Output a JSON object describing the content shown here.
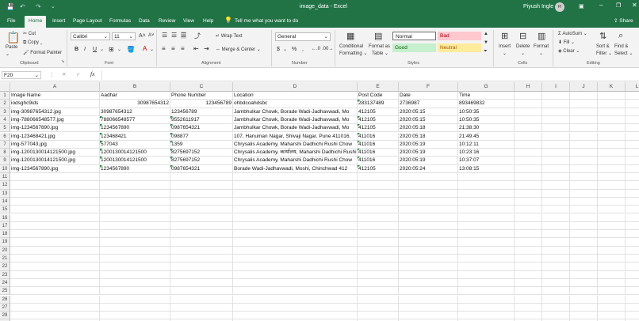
{
  "title": {
    "filename": "image_data",
    "separator": "-",
    "app": "Excel",
    "user": "Piyush Ingle",
    "initials": "PI"
  },
  "tabs": [
    "File",
    "Home",
    "Insert",
    "Page Layout",
    "Formulas",
    "Data",
    "Review",
    "View",
    "Help"
  ],
  "tellme": "Tell me what you want to do",
  "share": "Share",
  "ribbon": {
    "clipboard": {
      "label": "Clipboard",
      "paste": "Paste",
      "cut": "Cut",
      "copy": "Copy",
      "painter": "Format Painter"
    },
    "font": {
      "label": "Font",
      "name": "Calibri",
      "size": "11",
      "bold": "B",
      "italic": "I",
      "underline": "U",
      "grow": "A",
      "shrink": "A"
    },
    "alignment": {
      "label": "Alignment",
      "wrap": "Wrap Text",
      "merge": "Merge & Center"
    },
    "number": {
      "label": "Number",
      "format": "General",
      "currency": "$",
      "percent": "%",
      "comma": ","
    },
    "styles": {
      "label": "Styles",
      "conditional": "Conditional",
      "formatting": "Formatting",
      "format_as": "Format as",
      "table": "Table",
      "normal": "Normal",
      "bad": "Bad",
      "good": "Good",
      "neutral": "Neutral"
    },
    "cells": {
      "label": "Cells",
      "insert": "Insert",
      "delete": "Delete",
      "format": "Format"
    },
    "editing": {
      "label": "Editing",
      "autosum": "AutoSum",
      "fill": "Fill",
      "clear": "Clear",
      "sort1": "Sort &",
      "sort2": "Filter",
      "find1": "Find &",
      "find2": "Select"
    }
  },
  "formula_bar": {
    "name_box": "F20",
    "fx": "fx",
    "value": ""
  },
  "columns": [
    "A",
    "B",
    "C",
    "D",
    "E",
    "F",
    "G",
    "H",
    "I",
    "J",
    "K",
    "L"
  ],
  "rows": [
    [
      "Image Name",
      "Aadhar",
      "Phone Number",
      "Location",
      "Post Code",
      "Date",
      "Time"
    ],
    [
      "iodsghc9ids",
      "30987654312",
      "123456789",
      "ohbdcoahdsbc",
      "283137489",
      "2736987",
      "893469832"
    ],
    [
      "img-30987654312.jpg",
      "30987654312",
      "123456789",
      "Jambhulkar Chowk, Borade Wadi-Jadhavwadi, Mo",
      "412105",
      "2020:05:15",
      "10:50:35"
    ],
    [
      "img-788066548577.jpg",
      "788066548577",
      "9552611917",
      "Jambhulkar Chowk, Borade Wadi-Jadhavwadi, Mo",
      "412105",
      "2020:05:15",
      "10:50:35"
    ],
    [
      "img-1234567890.jpg",
      "1234567890",
      "0987654321",
      "Jambhulkar Chowk, Borade Wadi-Jadhavwadi, Mo",
      "412105",
      "2020:05:18",
      "21:38:30"
    ],
    [
      "img-123468421.jpg",
      "123468421",
      "098877",
      "107, Hanuman Nagar, Shivaji Nagar, Pune 411016,",
      "411016",
      "2020:05:18",
      "21:49:45"
    ],
    [
      "img-577043.jpg",
      "577043",
      "1359",
      "Chrysalis Academy, Maharshi Dadhichi Rushi Chow",
      "411016",
      "2020:05:19",
      "10:12:11"
    ],
    [
      "img-1200130014121500.jpg",
      "1200130014121500",
      "8275697152",
      "Chrysalis Academy, कार्यालय, Maharshi Dadhichi Rushi Chow",
      "411016",
      "2020:05:19",
      "10:23:16"
    ],
    [
      "img-1200130014121500.jpg",
      "1200130014121500",
      "8275697152",
      "Chrysalis Academy, Maharshi Dadhichi Rushi Chow",
      "411016",
      "2020:05:19",
      "10:37:07"
    ],
    [
      "img-1234567890.jpg",
      "1234567890",
      "0987654321",
      "Borade Wadi-Jadhavwadi, Moshi, Chinchwad 412",
      "412105",
      "2020:05:24",
      "13:08:15"
    ]
  ],
  "row_numbers": [
    "1",
    "2",
    "3",
    "4",
    "5",
    "6",
    "7",
    "8",
    "9",
    "10",
    "11",
    "12",
    "13",
    "14",
    "15",
    "16",
    "17",
    "18",
    "19",
    "20",
    "21",
    "22",
    "23",
    "24",
    "25",
    "26",
    "27",
    "28",
    "29"
  ],
  "colors": {
    "excel_green": "#217346",
    "bad_bg": "#ffc7ce",
    "good_bg": "#c6efce",
    "neutral_bg": "#ffeb9c",
    "text_marker": "#1e8a3e"
  }
}
